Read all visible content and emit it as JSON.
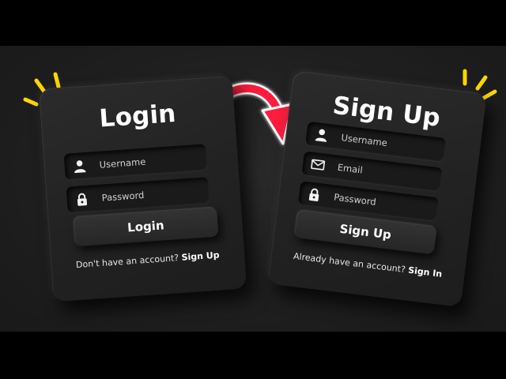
{
  "login": {
    "title": "Login",
    "username_placeholder": "Username",
    "password_placeholder": "Password",
    "button_label": "Login",
    "footer_text": "Don't have an account?",
    "footer_link": "Sign Up"
  },
  "signup": {
    "title": "Sign Up",
    "username_placeholder": "Username",
    "email_placeholder": "Email",
    "password_placeholder": "Password",
    "button_label": "Sign Up",
    "footer_text": "Already have an account?",
    "footer_link": "Sign In"
  },
  "colors": {
    "accent_arrow": "#ff1a3c",
    "spark": "#ffd600",
    "card": "#232323",
    "text": "#ffffff"
  },
  "icons": [
    "user-icon",
    "lock-icon",
    "mail-icon",
    "curved-arrow-icon",
    "sparkle-icon"
  ]
}
